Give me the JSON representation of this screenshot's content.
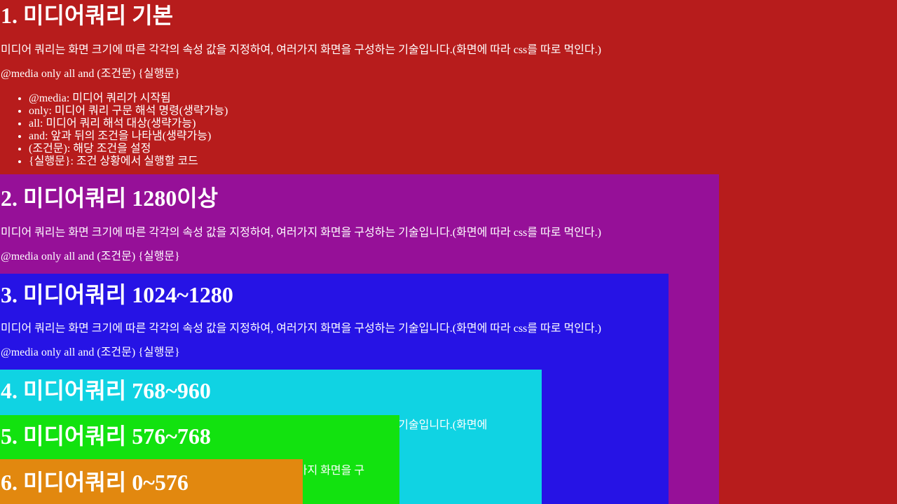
{
  "sections": [
    {
      "title": "1. 미디어쿼리 기본",
      "description": "미디어 쿼리는 화면 크기에 따른 각각의 속성 값을 지정하여, 여러가지 화면을 구성하는 기술입니다.(화면에 따라 css를 따로 먹인다.)",
      "syntax": "@media only all and (조건문) {실행문}",
      "items": [
        "@media: 미디어 쿼리가 시작됨",
        "only: 미디어 쿼리 구문 해석 명령(생략가능)",
        "all: 미디어 쿼리 해석 대상(생략가능)",
        "and: 앞과 뒤의 조건을 나타냄(생략가능)",
        "(조건문): 해당 조건을 설정",
        "{실행문}: 조건 상황에서 실행할 코드"
      ]
    },
    {
      "title": "2. 미디어쿼리 1280이상",
      "description": "미디어 쿼리는 화면 크기에 따른 각각의 속성 값을 지정하여, 여러가지 화면을 구성하는 기술입니다.(화면에 따라 css를 따로 먹인다.)",
      "syntax": "@media only all and (조건문) {실행문}"
    },
    {
      "title": "3. 미디어쿼리 1024~1280",
      "description": "미디어 쿼리는 화면 크기에 따른 각각의 속성 값을 지정하여, 여러가지 화면을 구성하는 기술입니다.(화면에 따라 css를 따로 먹인다.)",
      "syntax": "@media only all and (조건문) {실행문}"
    },
    {
      "title": "4. 미디어쿼리 768~960",
      "description": "미디어 쿼리는 화면 크기에 따른 각각의 속성 값을 지정하여, 여러가지 화면을 구성하는 기술입니다.(화면에"
    },
    {
      "title": "5. 미디어쿼리 576~768",
      "description": "미디어 쿼리는 화면 크기에 따른 각각의 속성 값을 지정하여, 여러가지 화면을 구"
    },
    {
      "title": "6. 미디어쿼리 0~576"
    }
  ],
  "colors": {
    "section1": "#b71c1c",
    "section2": "#961098",
    "section3": "#2613e5",
    "section4": "#10d3e3",
    "section5": "#12e20f",
    "section6": "#e2880f",
    "text": "#ffffff"
  }
}
